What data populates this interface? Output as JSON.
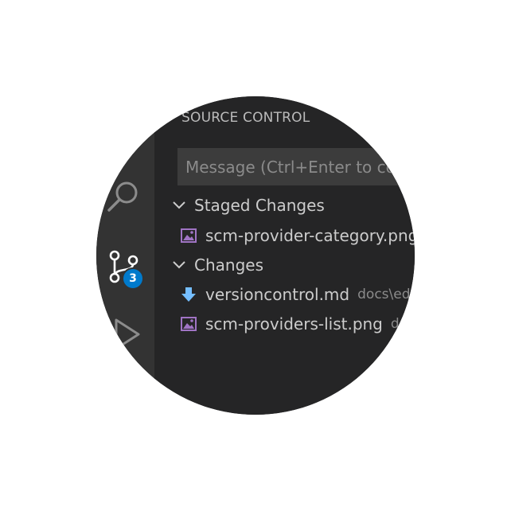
{
  "colors": {
    "activity_bar_bg": "#333333",
    "sidebar_bg": "#252526",
    "input_bg": "#3c3c3c",
    "text": "#cccccc",
    "muted_text": "#8b8b8b",
    "badge_bg": "#007acc",
    "image_icon": "#a074c4",
    "download_icon": "#75beff"
  },
  "activity_bar": {
    "items": [
      {
        "name": "search",
        "icon": "search-icon"
      },
      {
        "name": "source-control",
        "icon": "source-control-icon",
        "badge": "3"
      },
      {
        "name": "run",
        "icon": "run-icon"
      }
    ]
  },
  "sidebar": {
    "title": "SOURCE CONTROL",
    "commit_message": {
      "value": "",
      "placeholder": "Message (Ctrl+Enter to commit)"
    },
    "groups": [
      {
        "label": "Staged Changes",
        "files": [
          {
            "name": "scm-provider-category.png",
            "path": "",
            "icon": "image-file-icon"
          }
        ]
      },
      {
        "label": "Changes",
        "files": [
          {
            "name": "versioncontrol.md",
            "path": "docs\\editor",
            "icon": "download-arrow-icon"
          },
          {
            "name": "scm-providers-list.png",
            "path": "docs\\editor\\images",
            "icon": "image-file-icon"
          }
        ]
      }
    ]
  }
}
